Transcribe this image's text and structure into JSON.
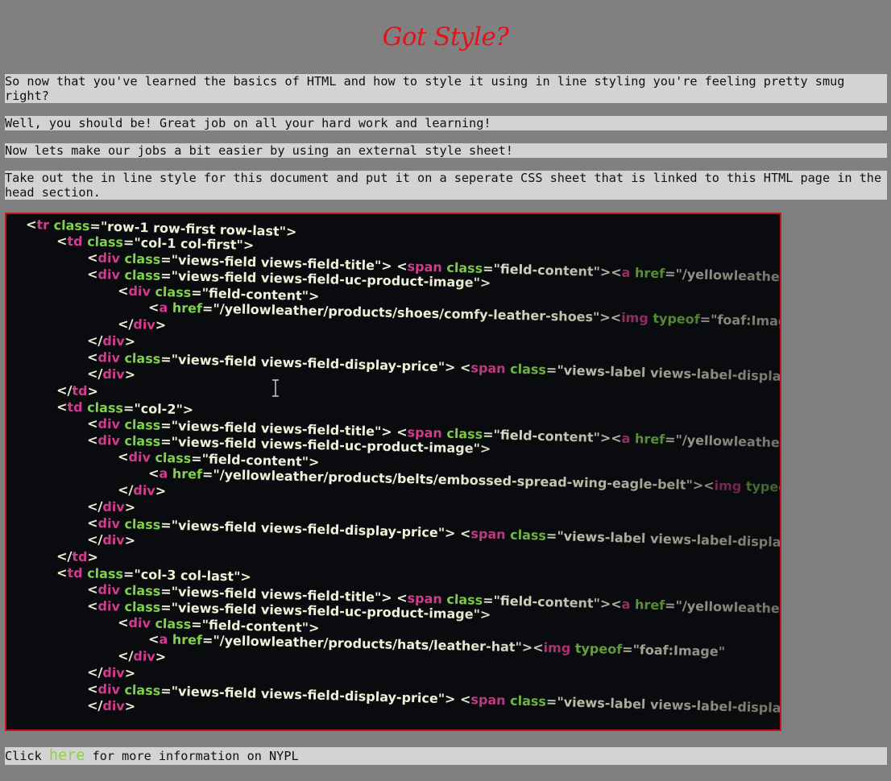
{
  "heading": "Got Style?",
  "paragraphs": {
    "p1": "So now that you've learned the basics of HTML and how to style it using in line styling you're feeling pretty smug right?",
    "p2": "Well, you should be! Great job on all your hard work and learning!",
    "p3": "Now lets make our jobs a bit easier by using an external style sheet!",
    "p4": "Take out the in line style for this document and put it on a seperate CSS sheet that is linked to this HTML page in the head section."
  },
  "footer": {
    "before": "Click ",
    "link_label": "here",
    "after": " for more information on NYPL"
  },
  "colors": {
    "background": "#808080",
    "paragraph_bg": "#d3d3d3",
    "heading": "#e8101a",
    "link": "#8fd141",
    "image_border": "#d0101a"
  },
  "code_image": {
    "lines": [
      {
        "indent": 0,
        "parts": [
          [
            "t",
            "<"
          ],
          [
            "g",
            "tr "
          ],
          [
            "c",
            "class"
          ],
          [
            "t",
            "=\"row-1 row-first row-last\">"
          ]
        ]
      },
      {
        "indent": 1,
        "parts": [
          [
            "t",
            "<"
          ],
          [
            "g",
            "td "
          ],
          [
            "c",
            "class"
          ],
          [
            "t",
            "=\"col-1 col-first\">"
          ]
        ]
      },
      {
        "indent": 2,
        "parts": [
          [
            "t",
            "<"
          ],
          [
            "g",
            "div "
          ],
          [
            "c",
            "class"
          ],
          [
            "t",
            "=\"views-field views-field-title\"> <"
          ],
          [
            "g",
            "span "
          ],
          [
            "c",
            "class"
          ],
          [
            "t",
            "=\"field-content\"><"
          ],
          [
            "g",
            "a "
          ],
          [
            "c",
            "href"
          ],
          [
            "t",
            "=\"/yellowleather/products/"
          ]
        ]
      },
      {
        "indent": 2,
        "parts": [
          [
            "t",
            "<"
          ],
          [
            "g",
            "div "
          ],
          [
            "c",
            "class"
          ],
          [
            "t",
            "=\"views-field views-field-uc-product-image\">"
          ]
        ]
      },
      {
        "indent": 3,
        "parts": [
          [
            "t",
            "<"
          ],
          [
            "g",
            "div "
          ],
          [
            "c",
            "class"
          ],
          [
            "t",
            "=\"field-content\">"
          ]
        ]
      },
      {
        "indent": 4,
        "parts": [
          [
            "t",
            "<"
          ],
          [
            "g",
            "a "
          ],
          [
            "c",
            "href"
          ],
          [
            "t",
            "=\"/yellowleather/products/shoes/comfy-leather-shoes\"><"
          ],
          [
            "g",
            "img "
          ],
          [
            "c",
            "typeof"
          ],
          [
            "t",
            "=\"foaf:Image\""
          ]
        ]
      },
      {
        "indent": 3,
        "parts": [
          [
            "t",
            "</"
          ],
          [
            "g",
            "div"
          ],
          [
            "t",
            ">"
          ]
        ]
      },
      {
        "indent": 2,
        "parts": [
          [
            "t",
            "</"
          ],
          [
            "g",
            "div"
          ],
          [
            "t",
            ">"
          ]
        ]
      },
      {
        "indent": 2,
        "parts": [
          [
            "t",
            "<"
          ],
          [
            "g",
            "div "
          ],
          [
            "c",
            "class"
          ],
          [
            "t",
            "=\"views-field views-field-display-price\"> <"
          ],
          [
            "g",
            "span "
          ],
          [
            "c",
            "class"
          ],
          [
            "t",
            "=\"views-label views-label-display-price\""
          ]
        ]
      },
      {
        "indent": 2,
        "parts": [
          [
            "t",
            "</"
          ],
          [
            "g",
            "div"
          ],
          [
            "t",
            ">"
          ]
        ]
      },
      {
        "indent": 1,
        "parts": [
          [
            "t",
            "</"
          ],
          [
            "g",
            "td"
          ],
          [
            "t",
            ">"
          ]
        ]
      },
      {
        "indent": 1,
        "parts": [
          [
            "t",
            "<"
          ],
          [
            "g",
            "td "
          ],
          [
            "c",
            "class"
          ],
          [
            "t",
            "=\"col-2\">"
          ]
        ]
      },
      {
        "indent": 2,
        "parts": [
          [
            "t",
            "<"
          ],
          [
            "g",
            "div "
          ],
          [
            "c",
            "class"
          ],
          [
            "t",
            "=\"views-field views-field-title\"> <"
          ],
          [
            "g",
            "span "
          ],
          [
            "c",
            "class"
          ],
          [
            "t",
            "=\"field-content\"><"
          ],
          [
            "g",
            "a "
          ],
          [
            "c",
            "href"
          ],
          [
            "t",
            "=\"/yellowleather/products/"
          ]
        ]
      },
      {
        "indent": 2,
        "parts": [
          [
            "t",
            "<"
          ],
          [
            "g",
            "div "
          ],
          [
            "c",
            "class"
          ],
          [
            "t",
            "=\"views-field views-field-uc-product-image\">"
          ]
        ]
      },
      {
        "indent": 3,
        "parts": [
          [
            "t",
            "<"
          ],
          [
            "g",
            "div "
          ],
          [
            "c",
            "class"
          ],
          [
            "t",
            "=\"field-content\">"
          ]
        ]
      },
      {
        "indent": 4,
        "parts": [
          [
            "t",
            "<"
          ],
          [
            "g",
            "a "
          ],
          [
            "c",
            "href"
          ],
          [
            "t",
            "=\"/yellowleather/products/belts/embossed-spread-wing-eagle-belt\"><"
          ],
          [
            "g",
            "img "
          ],
          [
            "c",
            "typeof"
          ]
        ]
      },
      {
        "indent": 3,
        "parts": [
          [
            "t",
            "</"
          ],
          [
            "g",
            "div"
          ],
          [
            "t",
            ">"
          ]
        ]
      },
      {
        "indent": 2,
        "parts": [
          [
            "t",
            "</"
          ],
          [
            "g",
            "div"
          ],
          [
            "t",
            ">"
          ]
        ]
      },
      {
        "indent": 2,
        "parts": [
          [
            "t",
            "<"
          ],
          [
            "g",
            "div "
          ],
          [
            "c",
            "class"
          ],
          [
            "t",
            "=\"views-field views-field-display-price\"> <"
          ],
          [
            "g",
            "span "
          ],
          [
            "c",
            "class"
          ],
          [
            "t",
            "=\"views-label views-label-display-price\""
          ]
        ]
      },
      {
        "indent": 2,
        "parts": [
          [
            "t",
            "</"
          ],
          [
            "g",
            "div"
          ],
          [
            "t",
            ">"
          ]
        ]
      },
      {
        "indent": 1,
        "parts": [
          [
            "t",
            "</"
          ],
          [
            "g",
            "td"
          ],
          [
            "t",
            ">"
          ]
        ]
      },
      {
        "indent": 1,
        "parts": [
          [
            "t",
            "<"
          ],
          [
            "g",
            "td "
          ],
          [
            "c",
            "class"
          ],
          [
            "t",
            "=\"col-3 col-last\">"
          ]
        ]
      },
      {
        "indent": 2,
        "parts": [
          [
            "t",
            "<"
          ],
          [
            "g",
            "div "
          ],
          [
            "c",
            "class"
          ],
          [
            "t",
            "=\"views-field views-field-title\"> <"
          ],
          [
            "g",
            "span "
          ],
          [
            "c",
            "class"
          ],
          [
            "t",
            "=\"field-content\"><"
          ],
          [
            "g",
            "a "
          ],
          [
            "c",
            "href"
          ],
          [
            "t",
            "=\"/yellowleather/products/"
          ]
        ]
      },
      {
        "indent": 2,
        "parts": [
          [
            "t",
            "<"
          ],
          [
            "g",
            "div "
          ],
          [
            "c",
            "class"
          ],
          [
            "t",
            "=\"views-field views-field-uc-product-image\">"
          ]
        ]
      },
      {
        "indent": 3,
        "parts": [
          [
            "t",
            "<"
          ],
          [
            "g",
            "div "
          ],
          [
            "c",
            "class"
          ],
          [
            "t",
            "=\"field-content\">"
          ]
        ]
      },
      {
        "indent": 4,
        "parts": [
          [
            "t",
            "<"
          ],
          [
            "g",
            "a "
          ],
          [
            "c",
            "href"
          ],
          [
            "t",
            "=\"/yellowleather/products/hats/leather-hat\"><"
          ],
          [
            "g",
            "img "
          ],
          [
            "c",
            "typeof"
          ],
          [
            "t",
            "=\"foaf:Image\""
          ]
        ]
      },
      {
        "indent": 3,
        "parts": [
          [
            "t",
            "</"
          ],
          [
            "g",
            "div"
          ],
          [
            "t",
            ">"
          ]
        ]
      },
      {
        "indent": 2,
        "parts": [
          [
            "t",
            "</"
          ],
          [
            "g",
            "div"
          ],
          [
            "t",
            ">"
          ]
        ]
      },
      {
        "indent": 2,
        "parts": [
          [
            "t",
            "<"
          ],
          [
            "g",
            "div "
          ],
          [
            "c",
            "class"
          ],
          [
            "t",
            "=\"views-field views-field-display-price\"> <"
          ],
          [
            "g",
            "span "
          ],
          [
            "c",
            "class"
          ],
          [
            "t",
            "=\"views-label views-label-display-price\""
          ]
        ]
      },
      {
        "indent": 2,
        "parts": [
          [
            "t",
            "</"
          ],
          [
            "g",
            "div"
          ],
          [
            "t",
            ">"
          ]
        ]
      }
    ],
    "colors": {
      "t": "#eef3d8",
      "g": "#d23c8e",
      "c": "#7fd34a"
    }
  }
}
